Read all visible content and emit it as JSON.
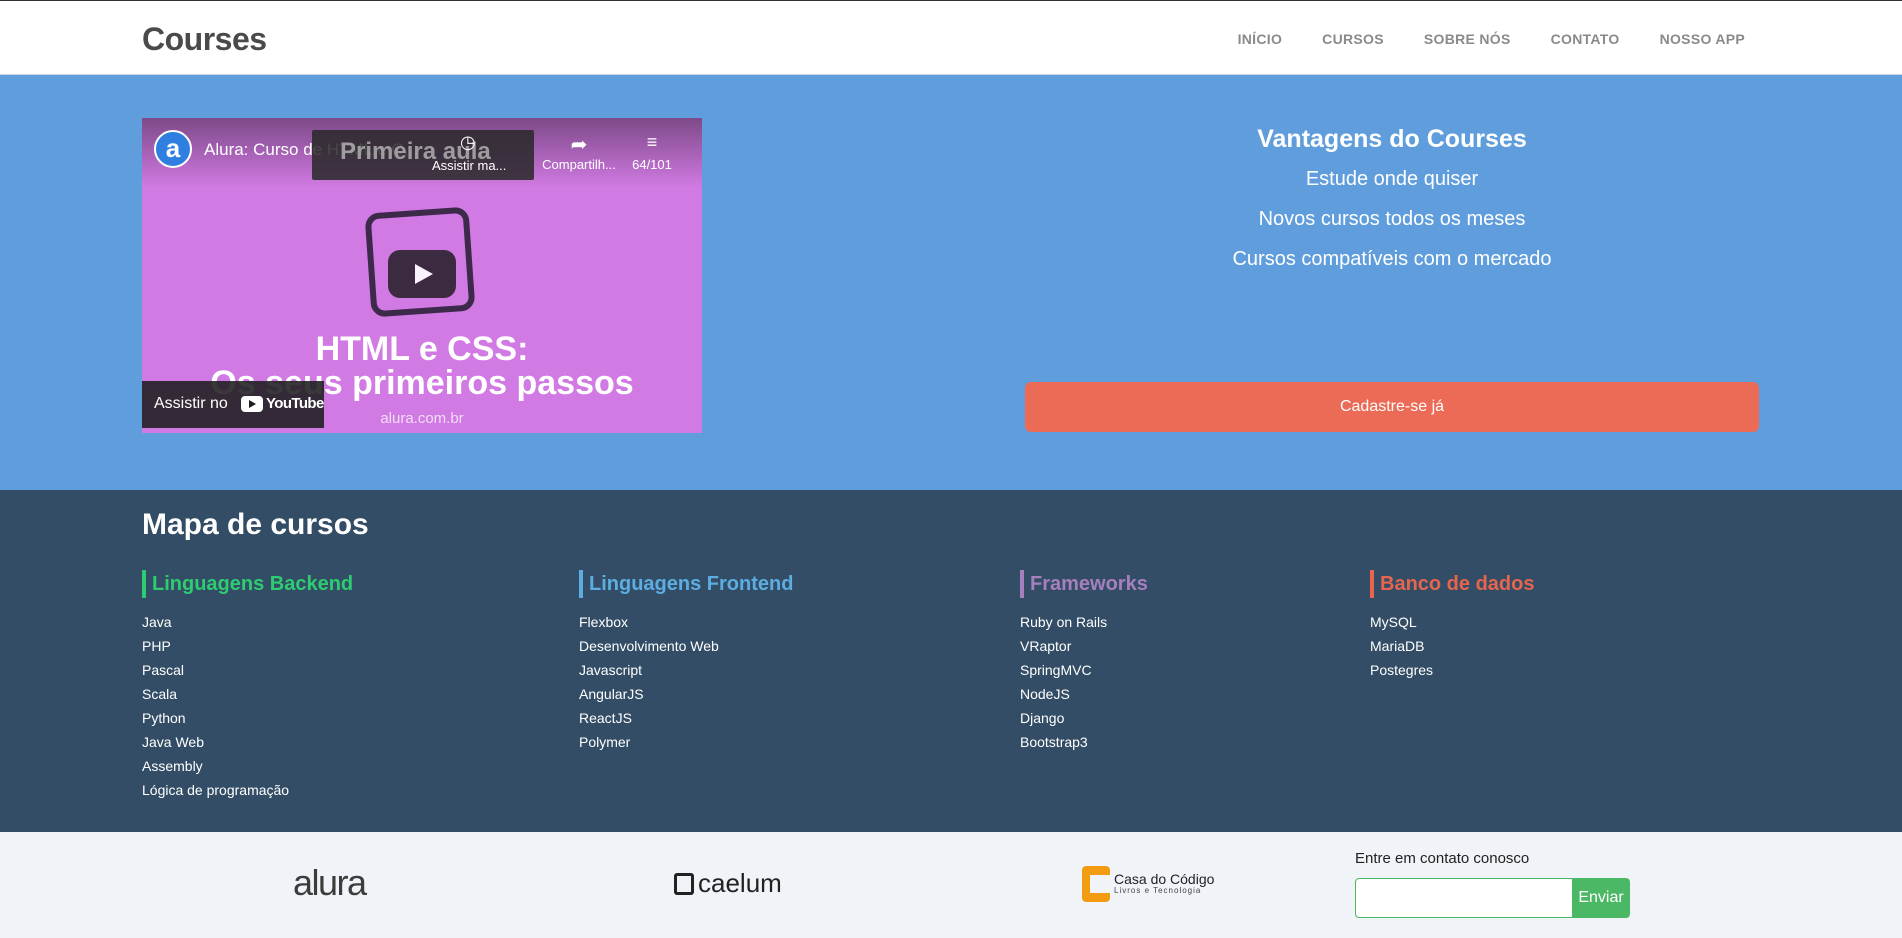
{
  "header": {
    "logo": "Courses",
    "nav": [
      "INÍCIO",
      "CURSOS",
      "SOBRE NÓS",
      "CONTATO",
      "NOSSO APP"
    ]
  },
  "video": {
    "channel_initial": "a",
    "title": "Alura: Curso de HTML e C...",
    "overlay_bg_text": "Primeira aula",
    "watch_later_label": "Assistir ma...",
    "share_label": "Compartilh...",
    "playlist_count": "64/101",
    "thumb_title_line1": "HTML e CSS:",
    "thumb_title_line2": "Os seus primeiros passos",
    "thumb_site": "alura.com.br",
    "watch_on_label": "Assistir no",
    "youtube_label": "YouTube"
  },
  "advantages": {
    "title": "Vantagens do Courses",
    "items": [
      "Estude onde quiser",
      "Novos cursos todos os meses",
      "Cursos compatíveis com o mercado"
    ],
    "signup_label": "Cadastre-se já"
  },
  "course_map": {
    "title": "Mapa de cursos",
    "columns": [
      {
        "title": "Linguagens Backend",
        "items": [
          "Java",
          "PHP",
          "Pascal",
          "Scala",
          "Python",
          "Java Web",
          "Assembly",
          "Lógica de programação"
        ]
      },
      {
        "title": "Linguagens Frontend",
        "items": [
          "Flexbox",
          "Desenvolvimento Web",
          "Javascript",
          "AngularJS",
          "ReactJS",
          "Polymer"
        ]
      },
      {
        "title": "Frameworks",
        "items": [
          "Ruby on Rails",
          "VRaptor",
          "SpringMVC",
          "NodeJS",
          "Django",
          "Bootstrap3"
        ]
      },
      {
        "title": "Banco de dados",
        "items": [
          "MySQL",
          "MariaDB",
          "Postegres"
        ]
      }
    ]
  },
  "footer": {
    "brands": {
      "alura": "alura",
      "caelum": "caelum",
      "cdc_line1": "Casa do Código",
      "cdc_line2": "Livros e Tecnologia"
    },
    "contact_label": "Entre em contato conosco",
    "contact_value": "",
    "send_label": "Enviar"
  },
  "colors": {
    "hero_bg": "#5f9ddd",
    "map_bg": "#324d65",
    "signup": "#ec6b56",
    "backend": "#2ecc71",
    "frontend": "#5dade2",
    "frameworks": "#a67fbf",
    "databases": "#e7654f",
    "send": "#4ab864"
  }
}
